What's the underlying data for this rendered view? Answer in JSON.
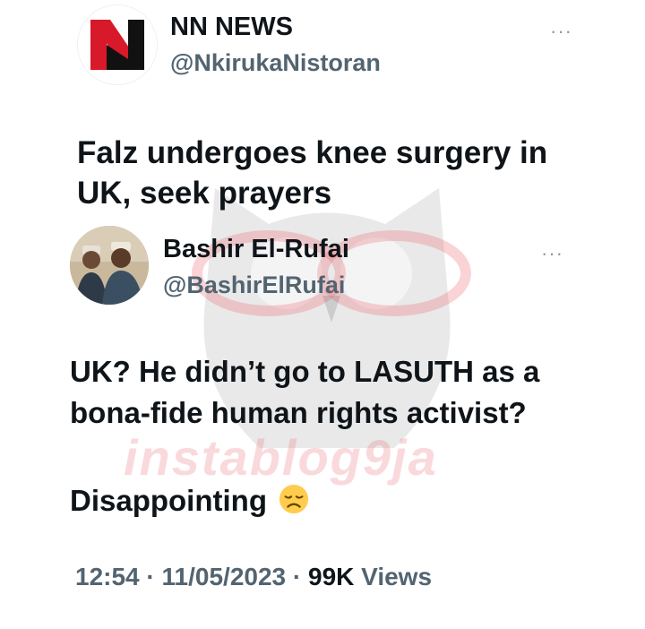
{
  "quoted_tweet": {
    "display_name": "NN NEWS",
    "handle": "@NkirukaNistoran",
    "text_line1": "Falz undergoes knee surgery in",
    "text_line2": "UK, seek prayers",
    "more_label": "···"
  },
  "tweet": {
    "display_name": "Bashir El-Rufai",
    "handle": "@BashirElRufai",
    "text_line1": "UK? He didn’t go to LASUTH as a",
    "text_line2": "bona-fide human rights activist?",
    "text_line3": "Disappointing",
    "emoji": "disappointed-face",
    "more_label": "···",
    "time": "12:54",
    "separator": " · ",
    "date": "11/05/2023",
    "views_count": "99K",
    "views_label": " Views"
  },
  "watermark": {
    "text": "instablog9ja"
  },
  "colors": {
    "text_primary": "#0f1419",
    "text_secondary": "#536471",
    "logo_red": "#d7192a",
    "logo_black": "#111111"
  }
}
